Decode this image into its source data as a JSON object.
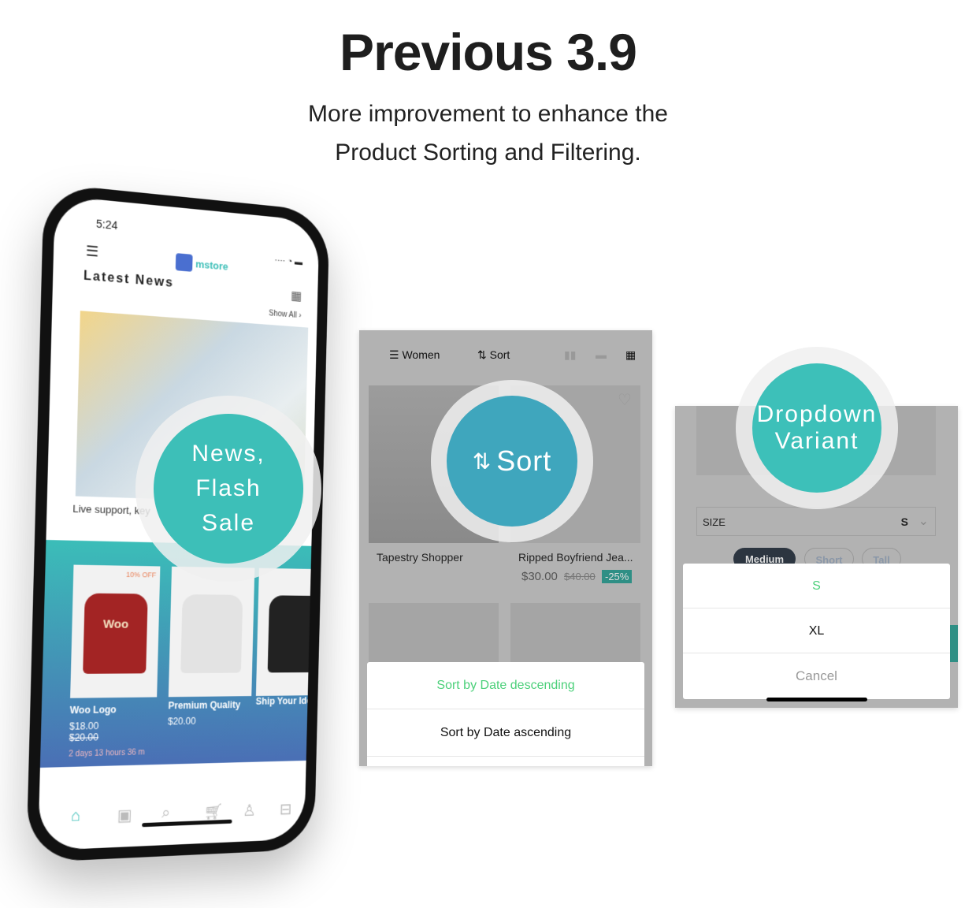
{
  "heading": {
    "title": "Previous 3.9",
    "subtitle_line1": "More improvement to enhance the",
    "subtitle_line2": "Product Sorting and Filtering."
  },
  "colors": {
    "teal": "#3dbfb8",
    "sort_blue": "#3fa6bd",
    "selected_green": "#4cd07a"
  },
  "phone": {
    "time": "5:24",
    "logo": "mstore",
    "section_title": "Latest News",
    "show_all": "Show All",
    "news_caption": "Live support, key",
    "badge": "News, Flash Sale",
    "products": [
      {
        "name": "Woo Logo",
        "price": "$18.00",
        "old_price": "$20.00",
        "discount": "10% OFF",
        "tee_text": "Woo"
      },
      {
        "name": "Premium Quality",
        "price": "$20.00"
      },
      {
        "name": "Ship Your Idea"
      }
    ],
    "countdown": "2 days 13 hours 36 m",
    "tabs": [
      "home-icon",
      "category-icon",
      "search-icon",
      "cart-icon",
      "user-icon",
      "bag-icon"
    ]
  },
  "sort_panel": {
    "filter_label": "Women",
    "sort_label": "Sort",
    "badge": "Sort",
    "products": [
      {
        "name": "Tapestry Shopper"
      },
      {
        "name": "Ripped Boyfriend Jea...",
        "price": "$30.00",
        "old_price": "$40.00",
        "discount": "-25%"
      }
    ],
    "options": [
      "Sort by Date descending",
      "Sort by Date ascending"
    ]
  },
  "variant_panel": {
    "badge_line1": "Dropdown",
    "badge_line2": "Variant",
    "size_label": "SIZE",
    "size_value": "S",
    "pills": [
      "Medium",
      "Short",
      "Tall"
    ],
    "options": [
      "S",
      "XL"
    ],
    "cancel": "Cancel"
  }
}
